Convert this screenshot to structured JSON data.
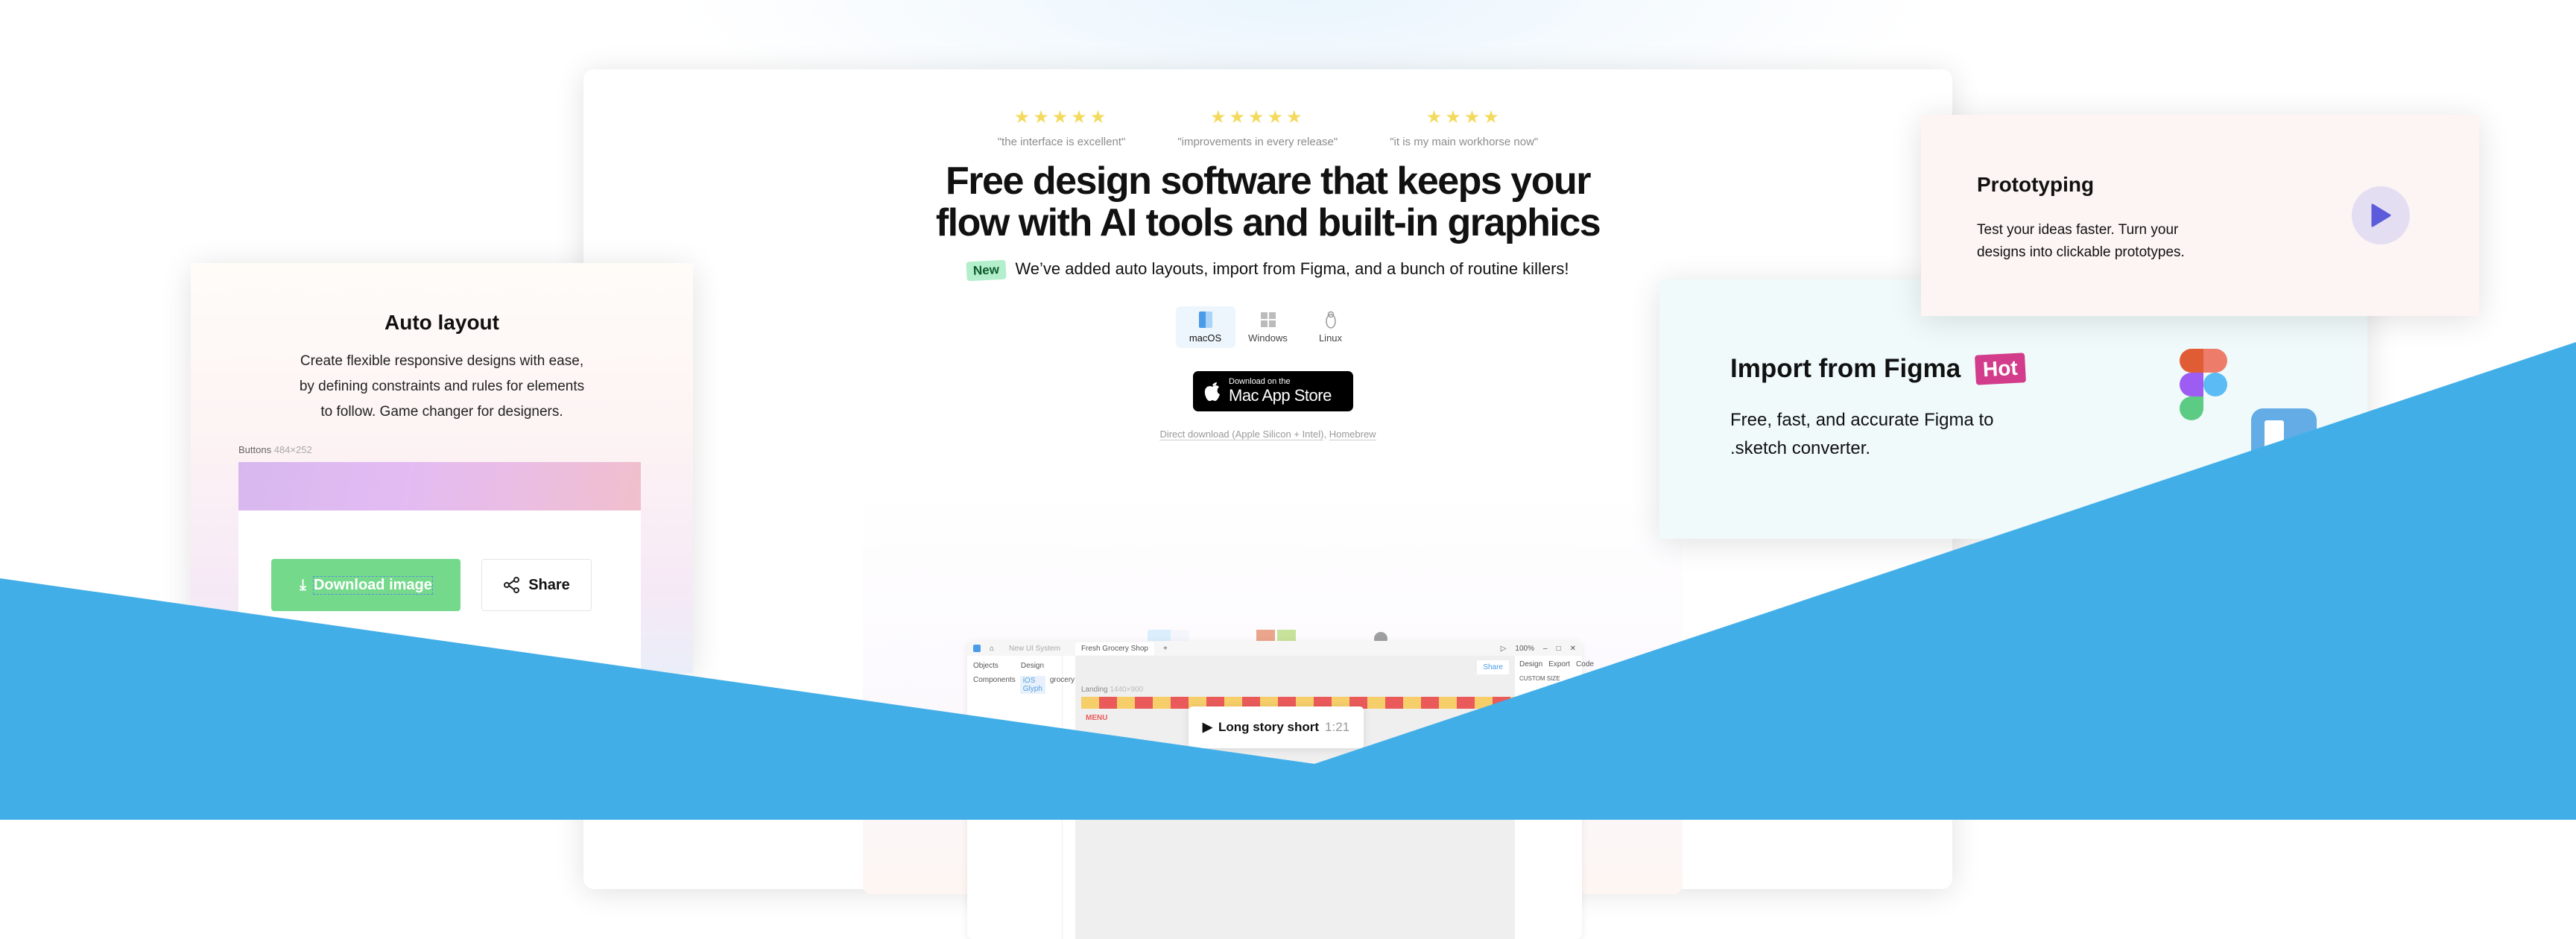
{
  "hero": {
    "reviews": [
      {
        "stars": "★★★★★",
        "rating": 5,
        "quote": "\"the interface is excellent\""
      },
      {
        "stars": "★★★★★",
        "rating": 4.5,
        "quote": "\"improvements in every release\""
      },
      {
        "stars": "★★★★",
        "rating": 4.5,
        "quote": "\"it is my main workhorse now\""
      }
    ],
    "headline_line1": "Free design software that keeps your",
    "headline_line2": "flow with AI tools and built-in graphics",
    "new_badge": "New",
    "announcement": "We’ve added auto layouts, import from Figma, and a bunch of routine killers!",
    "os_tabs": [
      {
        "label": "macOS",
        "icon": "finder-icon",
        "active": true
      },
      {
        "label": "Windows",
        "icon": "windows-icon"
      },
      {
        "label": "Linux",
        "icon": "linux-icon"
      }
    ],
    "appstore_small": "Download on the",
    "appstore_big": "Mac App Store",
    "direct_download": "Direct download (Apple Silicon + Intel)",
    "homebrew": "Homebrew"
  },
  "mini_app": {
    "tabs": [
      "New UI System",
      "Fresh Grocery Shop"
    ],
    "zoom": "100%",
    "panel_title": "Design",
    "objects": "Objects",
    "components": "Components",
    "search_tag": "iOS Glyph",
    "search_value": "grocery",
    "share": "Share",
    "right_tabs": [
      "Design",
      "Export",
      "Code"
    ],
    "custom_size": "CUSTOM SIZE",
    "frame_label": "Landing",
    "frame_size": "1440×900",
    "menu": "MENU"
  },
  "video": {
    "title": "Long story short",
    "duration": "1:21"
  },
  "auto_layout": {
    "title": "Auto layout",
    "desc_1": "Create flexible responsive designs with ease,",
    "desc_2": "by defining constraints and rules for elements",
    "desc_3": "to follow. Game changer for designers.",
    "frame_name": "Buttons",
    "frame_size": "484×252",
    "download_button": "Download image",
    "share_button": "Share"
  },
  "prototyping": {
    "title": "Prototyping",
    "desc_1": "Test your ideas faster. Turn your",
    "desc_2": "designs into clickable prototypes."
  },
  "figma": {
    "title": "Import from Figma",
    "badge": "Hot",
    "desc_1": "Free, fast, and accurate Figma to",
    "desc_2": ".sketch converter."
  },
  "colors": {
    "blue_band": "#42aee8",
    "download_green": "#74d98b",
    "hot_pink": "#d23c8a",
    "new_green": "#b3efcc",
    "star_yellow": "#f3da5e",
    "play_purple": "#5b5bdb"
  }
}
